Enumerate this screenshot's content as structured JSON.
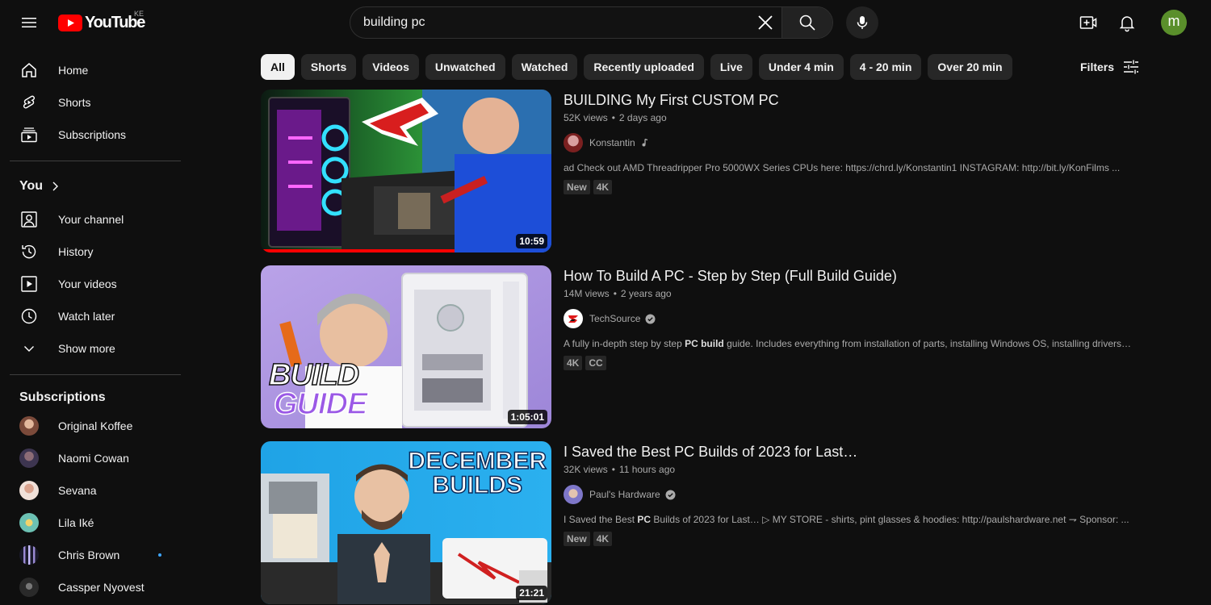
{
  "header": {
    "logo_text": "YouTube",
    "country_code": "KE",
    "search_value": "building pc",
    "avatar_letter": "m"
  },
  "sidebar": {
    "main": [
      {
        "label": "Home",
        "icon": "home-icon"
      },
      {
        "label": "Shorts",
        "icon": "shorts-icon"
      },
      {
        "label": "Subscriptions",
        "icon": "subscriptions-icon"
      }
    ],
    "you_heading": "You",
    "you_items": [
      {
        "label": "Your channel",
        "icon": "account-icon"
      },
      {
        "label": "History",
        "icon": "history-icon"
      },
      {
        "label": "Your videos",
        "icon": "your-videos-icon"
      },
      {
        "label": "Watch later",
        "icon": "watch-later-icon"
      },
      {
        "label": "Show more",
        "icon": "chevron-down-icon"
      }
    ],
    "subs_heading": "Subscriptions",
    "subscriptions": [
      {
        "name": "Original Koffee",
        "color": "#b07a5c"
      },
      {
        "name": "Naomi Cowan",
        "color": "#6b5a7a"
      },
      {
        "name": "Sevana",
        "color": "#c79a86"
      },
      {
        "name": "Lila Iké",
        "color": "#8fbf9a"
      },
      {
        "name": "Chris Brown",
        "color": "#2a2a3a",
        "live": true
      },
      {
        "name": "Cassper Nyovest",
        "color": "#3a3a3a"
      }
    ]
  },
  "chips": [
    "All",
    "Shorts",
    "Videos",
    "Unwatched",
    "Watched",
    "Recently uploaded",
    "Live",
    "Under 4 min",
    "4 - 20 min",
    "Over 20 min"
  ],
  "active_chip": "All",
  "filters_label": "Filters",
  "results": [
    {
      "title": "BUILDING My First CUSTOM PC",
      "views": "52K views",
      "age": "2 days ago",
      "channel": "Konstantin",
      "channel_badge": "music-note-icon",
      "description_pre": "ad Check out AMD Threadripper Pro 5000WX Series CPUs here: https://chrd.ly/Konstantin1 INSTAGRAM: http://bit.ly/KonFilms ...",
      "description_bold": "",
      "description_post": "",
      "tags": [
        "New",
        "4K"
      ],
      "duration": "10:59",
      "watched_fraction": 0.67
    },
    {
      "title": "How To Build A PC - Step by Step (Full Build Guide)",
      "views": "14M views",
      "age": "2 years ago",
      "channel": "TechSource",
      "channel_badge": "verified-icon",
      "description_pre": "A fully in-depth step by step ",
      "description_bold": "PC build",
      "description_post": " guide. Includes everything from installation of parts, installing Windows OS, installing drivers, ...",
      "tags": [
        "4K",
        "CC"
      ],
      "duration": "1:05:01",
      "thumb_text": [
        "BUILD",
        "GUIDE"
      ]
    },
    {
      "title": "I Saved the Best PC Builds of 2023 for Last…",
      "views": "32K views",
      "age": "11 hours ago",
      "channel": "Paul's Hardware",
      "channel_badge": "verified-icon",
      "description_pre": "I Saved the Best ",
      "description_bold": "PC",
      "description_post": " Builds of 2023 for Last… ▷ MY STORE - shirts, pint glasses & hoodies: http://paulshardware.net ⇁ Sponsor: ...",
      "tags": [
        "New",
        "4K"
      ],
      "duration": "21:21",
      "thumb_text": [
        "DECEMBER",
        "BUILDS"
      ]
    }
  ]
}
